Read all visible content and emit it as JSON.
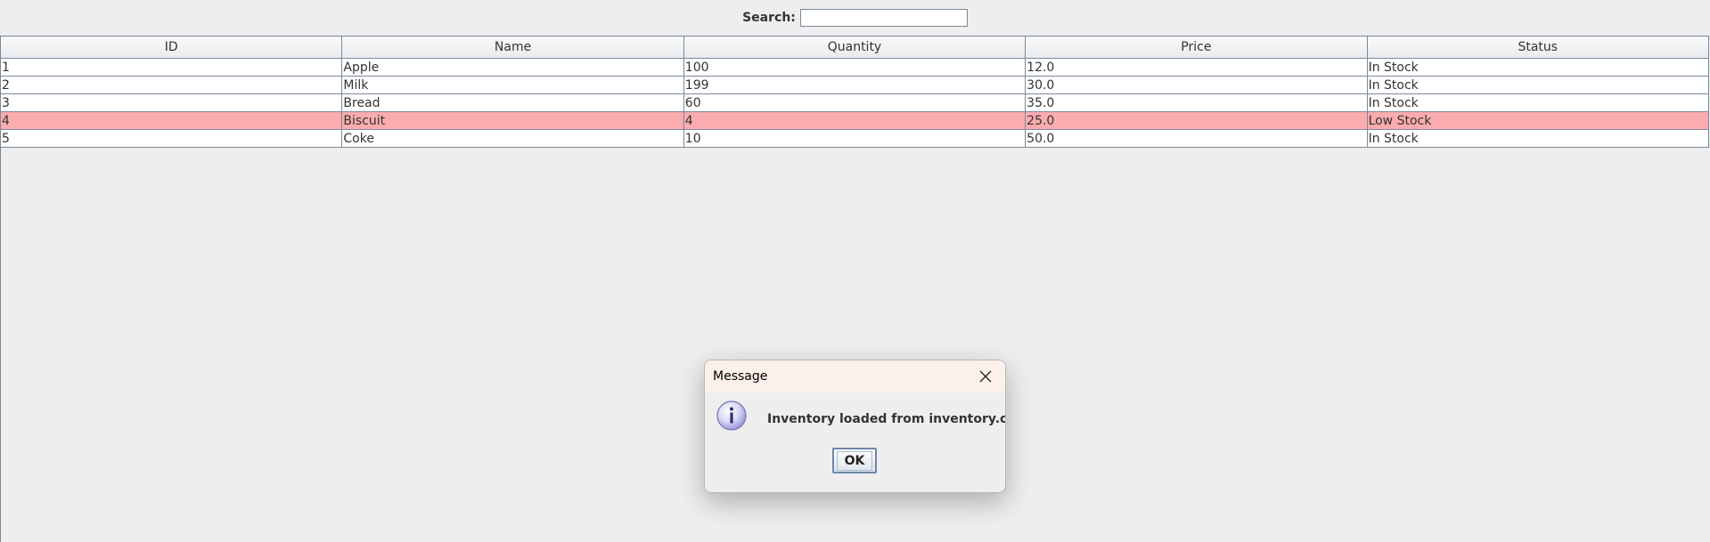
{
  "search": {
    "label": "Search:",
    "value": ""
  },
  "table": {
    "columns": [
      "ID",
      "Name",
      "Quantity",
      "Price",
      "Status"
    ],
    "rows": [
      {
        "id": "1",
        "name": "Apple",
        "quantity": "100",
        "price": "12.0",
        "status": "In Stock"
      },
      {
        "id": "2",
        "name": "Milk",
        "quantity": "199",
        "price": "30.0",
        "status": "In Stock"
      },
      {
        "id": "3",
        "name": "Bread",
        "quantity": "60",
        "price": "35.0",
        "status": "In Stock"
      },
      {
        "id": "4",
        "name": "Biscuit",
        "quantity": "4",
        "price": "25.0",
        "status": "Low Stock"
      },
      {
        "id": "5",
        "name": "Coke",
        "quantity": "10",
        "price": "50.0",
        "status": "In Stock"
      }
    ],
    "low_stock_color": "#fbacae"
  },
  "dialog": {
    "title": "Message",
    "message": "Inventory loaded from inventory.csv",
    "ok_label": "OK",
    "icon": "info-icon",
    "close_icon": "close-icon"
  }
}
